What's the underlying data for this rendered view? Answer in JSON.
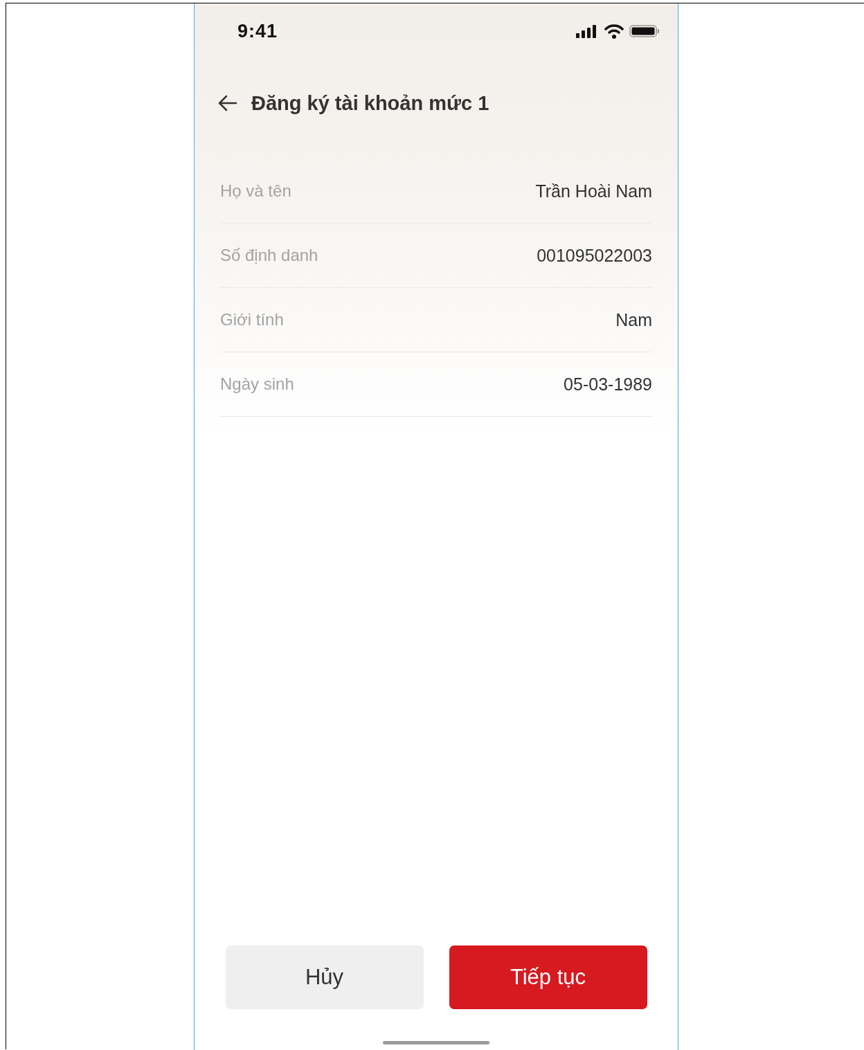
{
  "status_bar": {
    "time": "9:41"
  },
  "header": {
    "title": "Đăng ký tài khoản mức 1"
  },
  "fields": [
    {
      "label": "Họ và tên",
      "value": "Trần Hoài Nam"
    },
    {
      "label": "Số định danh",
      "value": "001095022003"
    },
    {
      "label": "Giới tính",
      "value": "Nam"
    },
    {
      "label": "Ngày sinh",
      "value": "05-03-1989"
    }
  ],
  "buttons": [
    {
      "label": "Hủy",
      "kind": "secondary"
    },
    {
      "label": "Tiếp tục",
      "kind": "primary"
    }
  ]
}
